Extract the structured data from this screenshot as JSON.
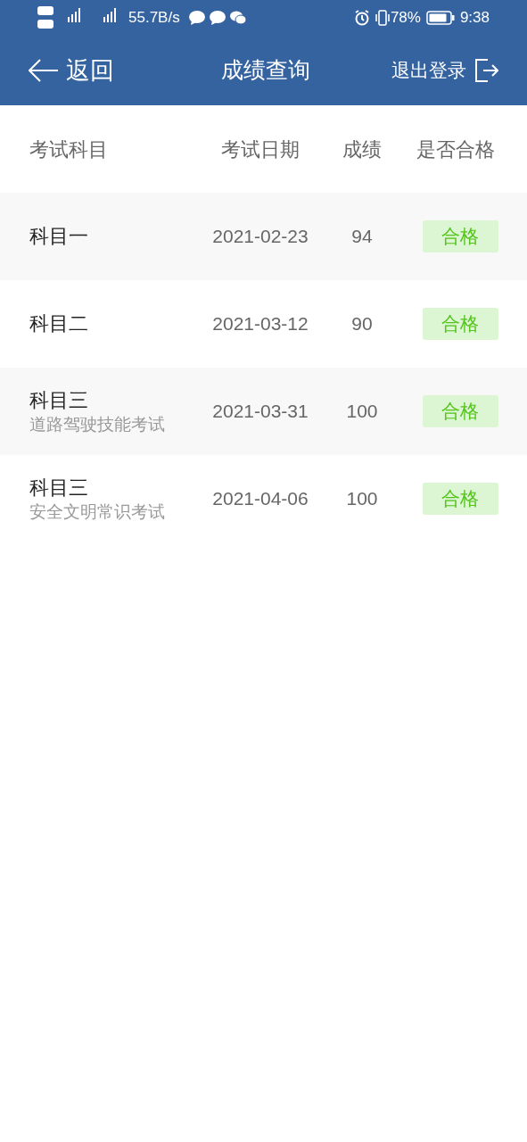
{
  "status_bar": {
    "network_speed": "55.7B/s",
    "battery": "78%",
    "time": "9:38"
  },
  "header": {
    "back": "返回",
    "title": "成绩查询",
    "logout": "退出登录"
  },
  "table": {
    "columns": [
      "考试科目",
      "考试日期",
      "成绩",
      "是否合格"
    ],
    "rows": [
      {
        "subject": "科目一",
        "date": "2021-02-23",
        "score": "94",
        "result": "合格"
      },
      {
        "subject": "科目二",
        "date": "2021-03-12",
        "score": "90",
        "result": "合格"
      },
      {
        "subject": "科目三",
        "detail": "道路驾驶技能考试",
        "date": "2021-03-31",
        "score": "100",
        "result": "合格"
      },
      {
        "subject": "科目三",
        "detail": "安全文明常识考试",
        "date": "2021-04-06",
        "score": "100",
        "result": "合格"
      }
    ]
  }
}
